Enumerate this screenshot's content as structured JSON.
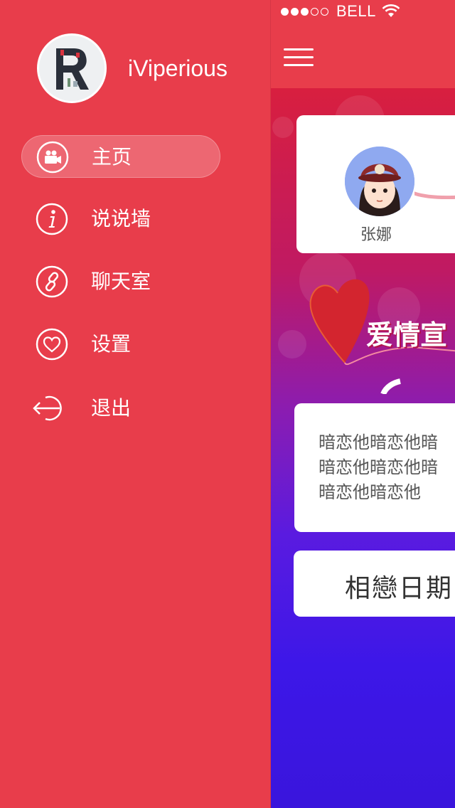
{
  "drawer": {
    "username": "iViperious",
    "menu": [
      {
        "label": "主页",
        "icon": "camera-icon",
        "active": true
      },
      {
        "label": "说说墙",
        "icon": "info-icon",
        "active": false
      },
      {
        "label": "聊天室",
        "icon": "link-icon",
        "active": false
      },
      {
        "label": "设置",
        "icon": "heart-icon",
        "active": false
      }
    ],
    "logout": {
      "label": "退出",
      "icon": "logout-icon"
    }
  },
  "status_bar": {
    "carrier": "BELL",
    "signal_strength": 3,
    "signal_max": 5
  },
  "main": {
    "partner_name": "张娜",
    "love_title": "爱情宣",
    "message_lines": [
      "暗恋他暗恋他暗",
      "暗恋他暗恋他暗",
      "暗恋他暗恋他"
    ],
    "date_label": "相戀日期"
  },
  "colors": {
    "primary": "#e83d4b",
    "gradient_top": "#d81f3f",
    "gradient_bottom": "#3a15dc"
  }
}
